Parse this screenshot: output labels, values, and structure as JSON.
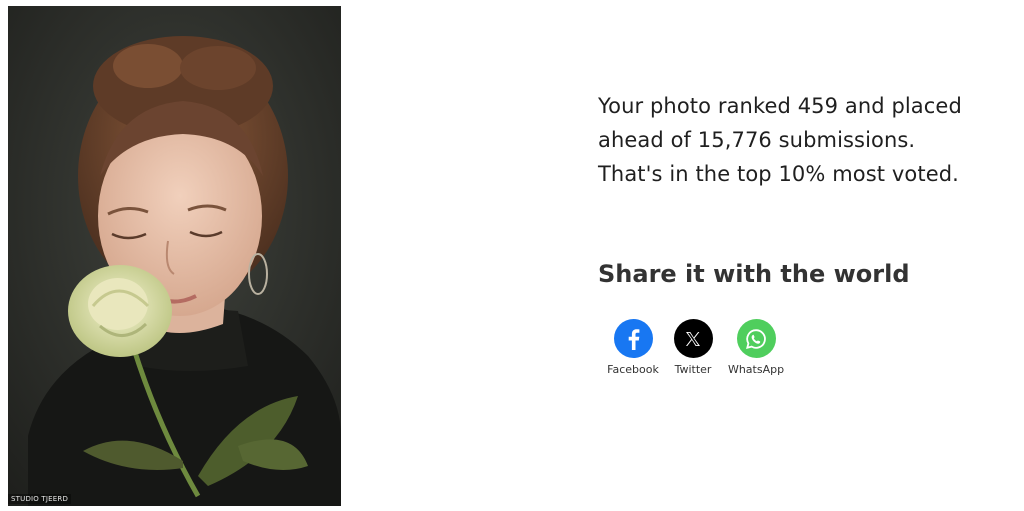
{
  "photo": {
    "watermark": "STUDIO TJEERD"
  },
  "result": {
    "lines": [
      "Your photo ranked 459 and placed",
      "ahead of 15,776 submissions.",
      "That's in the top 10% most voted."
    ]
  },
  "share": {
    "title": "Share it with the world",
    "buttons": [
      {
        "label": "Facebook",
        "icon": "facebook-icon",
        "color": "#1877f2"
      },
      {
        "label": "Twitter",
        "icon": "x-icon",
        "color": "#000000"
      },
      {
        "label": "WhatsApp",
        "icon": "whatsapp-icon",
        "color": "#4fce5d"
      }
    ]
  }
}
